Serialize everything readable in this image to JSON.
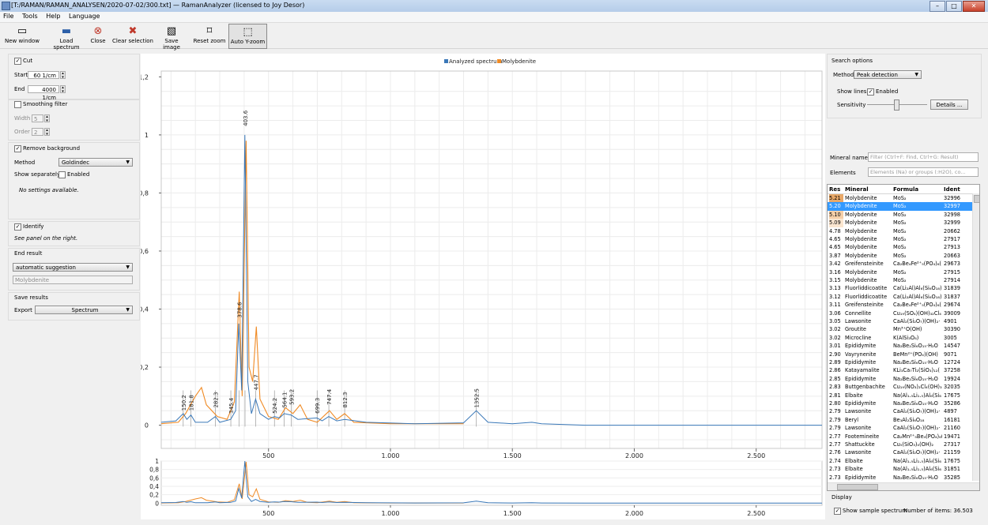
{
  "window": {
    "title": "[T:/RAMAN/RAMAN_ANALYSEN/2020-07-02/300.txt] — RamanAnalyzer (licensed to Joy Desor)"
  },
  "menu": [
    "File",
    "Tools",
    "Help",
    "Language"
  ],
  "toolbar": [
    {
      "label": "New window",
      "icon": "window-icon"
    },
    {
      "label": "Load spectrum",
      "icon": "save-icon"
    },
    {
      "label": "Close",
      "icon": "close-icon"
    },
    {
      "label": "Clear selection",
      "icon": "clear-icon"
    },
    {
      "label": "Save image",
      "icon": "image-icon"
    },
    {
      "label": "Reset zoom",
      "icon": "reset-zoom-icon"
    },
    {
      "label": "Auto Y-zoom",
      "icon": "auto-zoom-icon"
    }
  ],
  "left": {
    "cut": {
      "label": "Cut",
      "checked": true,
      "start_label": "Start",
      "start": "60 1/cm",
      "end_label": "End",
      "end": "4000 1/cm"
    },
    "smoothing": {
      "label": "Smoothing filter",
      "checked": false,
      "width_label": "Width",
      "width": "5",
      "order_label": "Order",
      "order": "2"
    },
    "background": {
      "label": "Remove background",
      "checked": true,
      "method_label": "Method",
      "method": "Goldindec",
      "separate_label": "Show separately",
      "enabled_label": "Enabled",
      "note": "No settings available."
    },
    "identify": {
      "label": "Identify",
      "checked": true,
      "note": "See panel on the right."
    },
    "end_result": {
      "label": "End result",
      "mode": "automatic suggestion",
      "value": "Molybdenite"
    },
    "save": {
      "label": "Save results",
      "export_label": "Export",
      "export": "Spectrum"
    }
  },
  "right": {
    "search_options": "Search options",
    "method_label": "Method",
    "method": "Peak detection",
    "show_lines_label": "Show lines",
    "enabled_label": "Enabled",
    "sensitivity_label": "Sensitivity",
    "sensitivity": 0.5,
    "details_label": "Details ...",
    "mineral_label": "Mineral name",
    "mineral_placeholder": "Filter (Ctrl+F: Find, Ctrl+G: Result)",
    "elements_label": "Elements",
    "elements_placeholder": "Elements (Na) or groups (:H2O), co...",
    "columns": [
      "Res",
      "Mineral",
      "Formula",
      "Ident"
    ],
    "rows": [
      [
        "5.21",
        "Molybdenite",
        "MoS₂",
        "32996"
      ],
      [
        "5.20",
        "Molybdenite",
        "MoS₂",
        "32997"
      ],
      [
        "5.10",
        "Molybdenite",
        "MoS₂",
        "32998"
      ],
      [
        "5.09",
        "Molybdenite",
        "MoS₂",
        "32999"
      ],
      [
        "4.78",
        "Molybdenite",
        "MoS₂",
        "20662"
      ],
      [
        "4.65",
        "Molybdenite",
        "MoS₂",
        "27917"
      ],
      [
        "4.65",
        "Molybdenite",
        "MoS₂",
        "27913"
      ],
      [
        "3.87",
        "Molybdenite",
        "MoS₂",
        "20663"
      ],
      [
        "3.42",
        "Greifensteinite",
        "Ca₂Be₄Fe²⁺₅(PO₄)₆(",
        "29673"
      ],
      [
        "3.16",
        "Molybdenite",
        "MoS₂",
        "27915"
      ],
      [
        "3.15",
        "Molybdenite",
        "MoS₂",
        "27914"
      ],
      [
        "3.13",
        "Fluorliddicoatite",
        "Ca(Li₂Al)Al₆(Si₆O₁₈)(",
        "31839"
      ],
      [
        "3.12",
        "Fluorliddicoatite",
        "Ca(Li₂Al)Al₆(Si₆O₁₈)(",
        "31837"
      ],
      [
        "3.11",
        "Greifensteinite",
        "Ca₂Be₄Fe²⁺₅(PO₄)₆(",
        "29674"
      ],
      [
        "3.06",
        "Connellite",
        "Cu₁₉(SO₄)(OH)₃₂Cl₄",
        "39009"
      ],
      [
        "3.05",
        "Lawsonite",
        "CaAl₂(Si₂O₇)(OH)₂·",
        "4901"
      ],
      [
        "3.02",
        "Groutite",
        "Mn³⁺O(OH)",
        "30390"
      ],
      [
        "3.02",
        "Microcline",
        "K(AlSi₃O₈)",
        "3005"
      ],
      [
        "3.01",
        "Epididymite",
        "Na₂Be₂Si₆O₁₅·H₂O",
        "14547"
      ],
      [
        "2.90",
        "Vayrynenite",
        "BeMn²⁺(PO₄)(OH)",
        "9071"
      ],
      [
        "2.89",
        "Epididymite",
        "Na₂Be₂Si₆O₁₅·H₂O",
        "12724"
      ],
      [
        "2.86",
        "Katayamalite",
        "KLi₃Ca₇Ti₂(SiO₃)₁₂(",
        "37258"
      ],
      [
        "2.85",
        "Epididymite",
        "Na₂Be₂Si₆O₁₅·H₂O",
        "19924"
      ],
      [
        "2.83",
        "Buttgenbachite",
        "Cu₁₉(NO₃)₂Cl₄(OH)₃",
        "32035"
      ],
      [
        "2.81",
        "Elbaite",
        "Na(Al₁.₅Li₁.₅)Al₆(Si₆",
        "17675"
      ],
      [
        "2.80",
        "Epididymite",
        "Na₂Be₂Si₆O₁₅·H₂O",
        "35286"
      ],
      [
        "2.79",
        "Lawsonite",
        "CaAl₂(Si₂O₇)(OH)₂·",
        "4897"
      ],
      [
        "2.79",
        "Beryl",
        "Be₃Al₂Si₆O₁₈",
        "16181"
      ],
      [
        "2.79",
        "Lawsonite",
        "CaAl₂(Si₂O₇)(OH)₂·",
        "21160"
      ],
      [
        "2.77",
        "Footemineite",
        "Ca₂Mn²⁺₅Be₄(PO₄)₆(",
        "19471"
      ],
      [
        "2.77",
        "Shattuckite",
        "Cu₅(SiO₃)₄(OH)₂",
        "27317"
      ],
      [
        "2.76",
        "Lawsonite",
        "CaAl₂(Si₂O₇)(OH)₂·",
        "21159"
      ],
      [
        "2.74",
        "Elbaite",
        "Na(Al₁.₅Li₁.₅)Al₆(Si₆",
        "17675"
      ],
      [
        "2.73",
        "Elbaite",
        "Na(Al₁.₅Li₁.₅)Al₆(Si₆",
        "31851"
      ],
      [
        "2.73",
        "Epididymite",
        "Na₂Be₂Si₆O₁₅·H₂O",
        "35285"
      ]
    ],
    "display_label": "Display",
    "show_sample_label": "Show sample spectrum",
    "items_label": "Number of items: 36.503"
  },
  "chart_data": {
    "type": "line",
    "legend": [
      "Analyzed spectrum",
      "Molybdenite"
    ],
    "legend_placement": "top-center",
    "colors": {
      "analyzed": "#3a78b8",
      "reference": "#f08a24"
    },
    "xlim": [
      60,
      2770
    ],
    "ylim": [
      -0.08,
      1.22
    ],
    "x_ticks": [
      500,
      1000,
      1500,
      2000,
      2500
    ],
    "x_tick_labels": [
      "500",
      "1.000",
      "1.500",
      "2.000",
      "2.500"
    ],
    "y_ticks": [
      0,
      0.2,
      0.4,
      0.6,
      0.8,
      1.0,
      1.2
    ],
    "y_tick_labels": [
      "0",
      "0,2",
      "0,4",
      "0,6",
      "0,8",
      "1",
      "1,2"
    ],
    "overview_y_ticks": [
      0,
      0.2,
      0.4,
      0.6,
      0.8,
      1
    ],
    "overview_y_tick_labels": [
      "0",
      "0,2",
      "0,4",
      "0,6",
      "0,8",
      "1"
    ],
    "peaks": [
      150.2,
      181.8,
      282.3,
      345.4,
      378.6,
      403.6,
      447.7,
      524.2,
      564.1,
      593.2,
      699.3,
      747.4,
      812.3,
      1352.5
    ],
    "analyzed": [
      [
        60,
        0.01
      ],
      [
        120,
        0.015
      ],
      [
        150,
        0.04
      ],
      [
        165,
        0.02
      ],
      [
        182,
        0.035
      ],
      [
        200,
        0.01
      ],
      [
        250,
        0.01
      ],
      [
        282,
        0.03
      ],
      [
        300,
        0.01
      ],
      [
        345,
        0.02
      ],
      [
        365,
        0.05
      ],
      [
        378,
        0.35
      ],
      [
        390,
        0.12
      ],
      [
        403,
        1.0
      ],
      [
        415,
        0.15
      ],
      [
        430,
        0.04
      ],
      [
        447,
        0.09
      ],
      [
        465,
        0.04
      ],
      [
        500,
        0.02
      ],
      [
        524,
        0.03
      ],
      [
        545,
        0.025
      ],
      [
        564,
        0.04
      ],
      [
        593,
        0.035
      ],
      [
        620,
        0.02
      ],
      [
        699,
        0.025
      ],
      [
        720,
        0.015
      ],
      [
        747,
        0.03
      ],
      [
        780,
        0.015
      ],
      [
        812,
        0.02
      ],
      [
        900,
        0.01
      ],
      [
        1100,
        0.005
      ],
      [
        1300,
        0.008
      ],
      [
        1352,
        0.05
      ],
      [
        1400,
        0.01
      ],
      [
        1500,
        0.005
      ],
      [
        1580,
        0.01
      ],
      [
        1620,
        0.005
      ],
      [
        1800,
        0.0
      ],
      [
        2100,
        0.0
      ],
      [
        2770,
        0.0
      ]
    ],
    "reference": [
      [
        60,
        0.005
      ],
      [
        130,
        0.01
      ],
      [
        160,
        0.04
      ],
      [
        200,
        0.1
      ],
      [
        225,
        0.13
      ],
      [
        245,
        0.07
      ],
      [
        290,
        0.03
      ],
      [
        330,
        0.02
      ],
      [
        360,
        0.08
      ],
      [
        380,
        0.46
      ],
      [
        392,
        0.1
      ],
      [
        408,
        0.98
      ],
      [
        420,
        0.2
      ],
      [
        435,
        0.15
      ],
      [
        450,
        0.34
      ],
      [
        465,
        0.09
      ],
      [
        500,
        0.03
      ],
      [
        540,
        0.02
      ],
      [
        570,
        0.06
      ],
      [
        600,
        0.04
      ],
      [
        630,
        0.07
      ],
      [
        660,
        0.02
      ],
      [
        700,
        0.01
      ],
      [
        750,
        0.05
      ],
      [
        780,
        0.02
      ],
      [
        812,
        0.04
      ],
      [
        850,
        0.01
      ],
      [
        1000,
        0.005
      ],
      [
        1300,
        0.005
      ]
    ]
  }
}
